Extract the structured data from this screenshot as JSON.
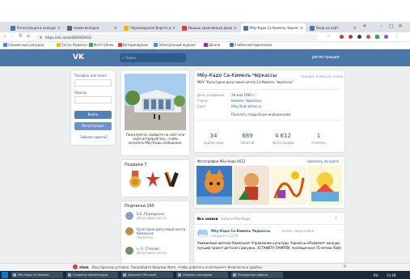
{
  "browser": {
    "tabs": [
      {
        "title": "Регистрация в конкурсе | ВКонтакте",
        "color": "#4a76a8",
        "active": false
      },
      {
        "title": "Новая вкладка",
        "color": "#5f6368",
        "active": false
      },
      {
        "title": "Черноморская Ворота для...",
        "color": "#f4b400",
        "active": false
      },
      {
        "title": "Ищешь креативный дизайн",
        "color": "#e53935",
        "active": false
      },
      {
        "title": "Мёу-Кадо Се-Кимель Черкассы",
        "color": "#4a76a8",
        "active": true
      },
      {
        "title": "Вход на сайт",
        "color": "#4a76a8",
        "active": false
      }
    ],
    "url": "https://vk.com/id391950410",
    "bookmarks": [
      {
        "label": "Справочные ресурсы",
        "color": "#4285f4"
      },
      {
        "label": "Тесты Яндекса",
        "color": "#fbbc05"
      },
      {
        "label": "Фото Vimeo",
        "color": "#34a853"
      },
      {
        "label": "Ветеринарные",
        "color": "#ea4335"
      },
      {
        "label": "Электронный журнал",
        "color": "#4285f4"
      },
      {
        "label": "Школа",
        "color": "#9c27b0"
      },
      {
        "label": "Учебно-методическое",
        "color": "#4a76a8"
      }
    ]
  },
  "vk": {
    "logo": "VK",
    "search_placeholder": "Поиск",
    "register_link": "регистрация",
    "login": {
      "phone_label": "Телефон или email",
      "password_label": "Пароль",
      "login_button": "Войти",
      "register_button": "Регистрация",
      "forgot": "Забыли пароль?"
    },
    "avatar_caption": "Пожалуйста, войдите на сайт или зарегистрируйтесь, чтобы написать Мёу-Кадо сообщение.",
    "gifts_label": "Подарки 7",
    "friends_label": "Подписки 165",
    "friends": [
      {
        "name": "Б.Е. Прохоренко",
        "sub": "Досуговый центр"
      },
      {
        "name": "Культурно-досуговый центр Кимельне",
        "sub": "Черкассы"
      },
      {
        "name": "н. Б. Стехова",
        "sub": "Досуговый центр"
      }
    ],
    "profile": {
      "name": "Мёу-Кадо Се-Кимель Черкассы",
      "status_online": "заходил 4 минуты назад",
      "status_line": "МБУ \"Культурно-досуговый центр Се-Кимель Черкассы\"",
      "details": [
        {
          "label": "День рождения:",
          "value": "28 мая 1960 г."
        },
        {
          "label": "Город:",
          "value": "Кимель Черкассы"
        },
        {
          "label": "Сайт:",
          "value": "http://kdc-kimel.ru"
        }
      ],
      "more_link": "Показать подробную информацию",
      "counters": [
        {
          "value": "34",
          "label": "подписчика"
        },
        {
          "value": "689",
          "label": "записей"
        },
        {
          "value": "4 612",
          "label": "фотографий"
        },
        {
          "value": "1",
          "label": "отметка"
        }
      ]
    },
    "photos_label": "Фотографии Мёу-Кадо 4612",
    "photos_link": "показать на карте",
    "wall_tabs": [
      "Все записи",
      "Записи Мёу-Кадо"
    ],
    "post": {
      "author": "Мёу-Кадо Се-Кимель Черкассы",
      "author_suffix": "запись закреплена",
      "time": "сегодня в 13:16",
      "text": "Уважаемые жители Кимельне! Управление культуры Черкассы объявляет конкурс мероприятий проекта «Культура» на...",
      "text2": "лучший проект детского рисунка. ЭСТАФЕТА ПАМЯТИ, посвященная 75-летию Победы"
    }
  },
  "notification": {
    "brand": "atom",
    "text": "Ваш браузер устарел. Попробуйте браузер Atom, чтобы работать в интернете безопасно и удобно."
  },
  "taskbar": {
    "items": [
      "Мёу-Кадо Се-Кимель",
      "Создание презентации",
      "Документ Microsoft",
      "Сборник сценариев",
      "Конкурсные работы"
    ],
    "tray": "RU",
    "clock": "13:18"
  }
}
